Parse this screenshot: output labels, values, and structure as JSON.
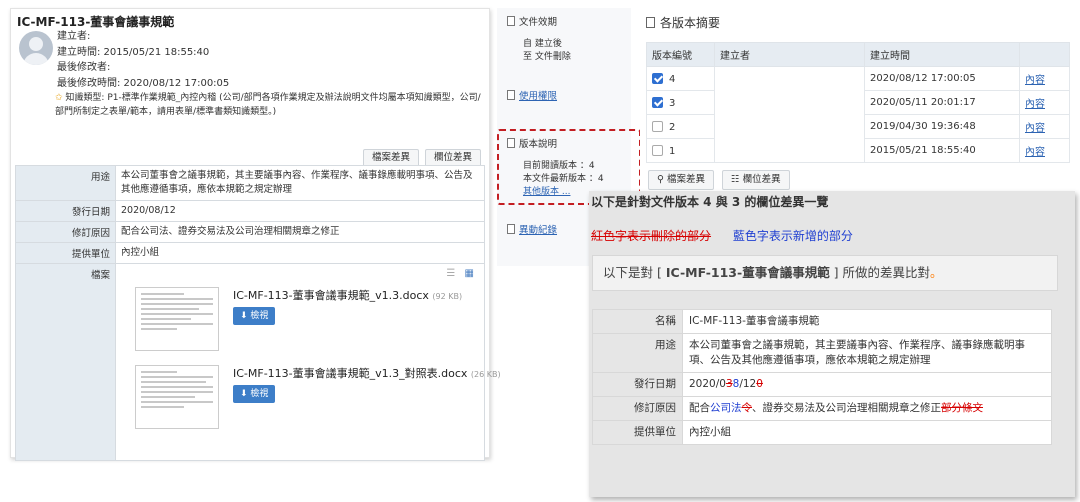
{
  "doc": {
    "title": "IC-MF-113-董事會議事規範",
    "creator": "建立者:",
    "created": "建立時間: 2015/05/21 18:55:40",
    "modifier": "最後修改者:",
    "modified": "最後修改時間: 2020/08/12 17:00:05",
    "knowledge": "知識類型: P1-標準作業規範_內控內稽 (公司/部門各項作業規定及辦法說明文件均屬本項知識類型，公司/部門所制定之表單/範本，請用表單/標準書類知識類型。)",
    "btn_file_diff": "檔案差異",
    "btn_field_diff": "欄位差異",
    "rows": {
      "purpose_label": "用途",
      "purpose": "本公司董事會之議事規範，其主要議事內容、作業程序、議事錄應載明事項、公告及其他應遵循事項，應依本規範之規定辦理",
      "date_label": "發行日期",
      "date": "2020/08/12",
      "reason_label": "修訂原因",
      "reason": "配合公司法、證券交易法及公司治理相關規章之修正",
      "unit_label": "提供單位",
      "unit": "內控小組",
      "files_label": "檔案"
    },
    "files": [
      {
        "name": "IC-MF-113-董事會議事規範_v1.3.docx",
        "size": "(92 KB)",
        "view": "檢視"
      },
      {
        "name": "IC-MF-113-董事會議事規範_v1.3_對照表.docx",
        "size": "(26 KB)",
        "view": "檢視"
      }
    ]
  },
  "menu": {
    "validity_title": "文件效期",
    "validity_line1": "自 建立後",
    "validity_line2": "至 文件刪除",
    "perm": "使用權限",
    "version_title": "版本說明",
    "current_version": "目前閱讀版本 ：4",
    "latest_version": "本文件最新版本 ：4",
    "other_versions": "其他版本 ...",
    "history": "異動紀錄"
  },
  "versions": {
    "title": "各版本摘要",
    "headers": [
      "版本編號",
      "建立者",
      "建立時間",
      ""
    ],
    "rows": [
      {
        "no": "4",
        "time": "2020/08/12 17:00:05",
        "link": "內容",
        "checked": true
      },
      {
        "no": "3",
        "time": "2020/05/11 20:01:17",
        "link": "內容",
        "checked": true
      },
      {
        "no": "2",
        "time": "2019/04/30 19:36:48",
        "link": "內容",
        "checked": false
      },
      {
        "no": "1",
        "time": "2015/05/21 18:55:40",
        "link": "內容",
        "checked": false
      }
    ],
    "btn_file_diff": "檔案差異",
    "btn_field_diff": "欄位差異"
  },
  "diff": {
    "heading": "以下是針對文件版本 4 與 3 的欄位差異一覽",
    "legend_red": "紅色字表示刪除的部分",
    "legend_blue": "藍色字表示新增的部分",
    "banner_pre": "以下是對 [ ",
    "banner_doc": "IC-MF-113-董事會議事規範",
    "banner_post": " ] 所做的差異比對",
    "banner_dot": "。",
    "name_label": "名稱",
    "name": "IC-MF-113-董事會議事規範",
    "purpose_label": "用途",
    "purpose": "本公司董事會之議事規範，其主要議事內容、作業程序、議事錄應載明事項、公告及其他應遵循事項，應依本規範之規定辦理",
    "date_label": "發行日期",
    "date_p1": "2020/0",
    "date_del1": "3",
    "date_add1": "8",
    "date_p2": "/12",
    "date_del2": "0",
    "reason_label": "修訂原因",
    "reason_p1": "配合",
    "reason_add1": "公司法",
    "reason_del1": "令",
    "reason_p2": "、證券交易法及公司治理相關規章",
    "reason_p3": "之修正",
    "reason_del2": "部分條文",
    "unit_label": "提供單位",
    "unit": "內控小組"
  }
}
